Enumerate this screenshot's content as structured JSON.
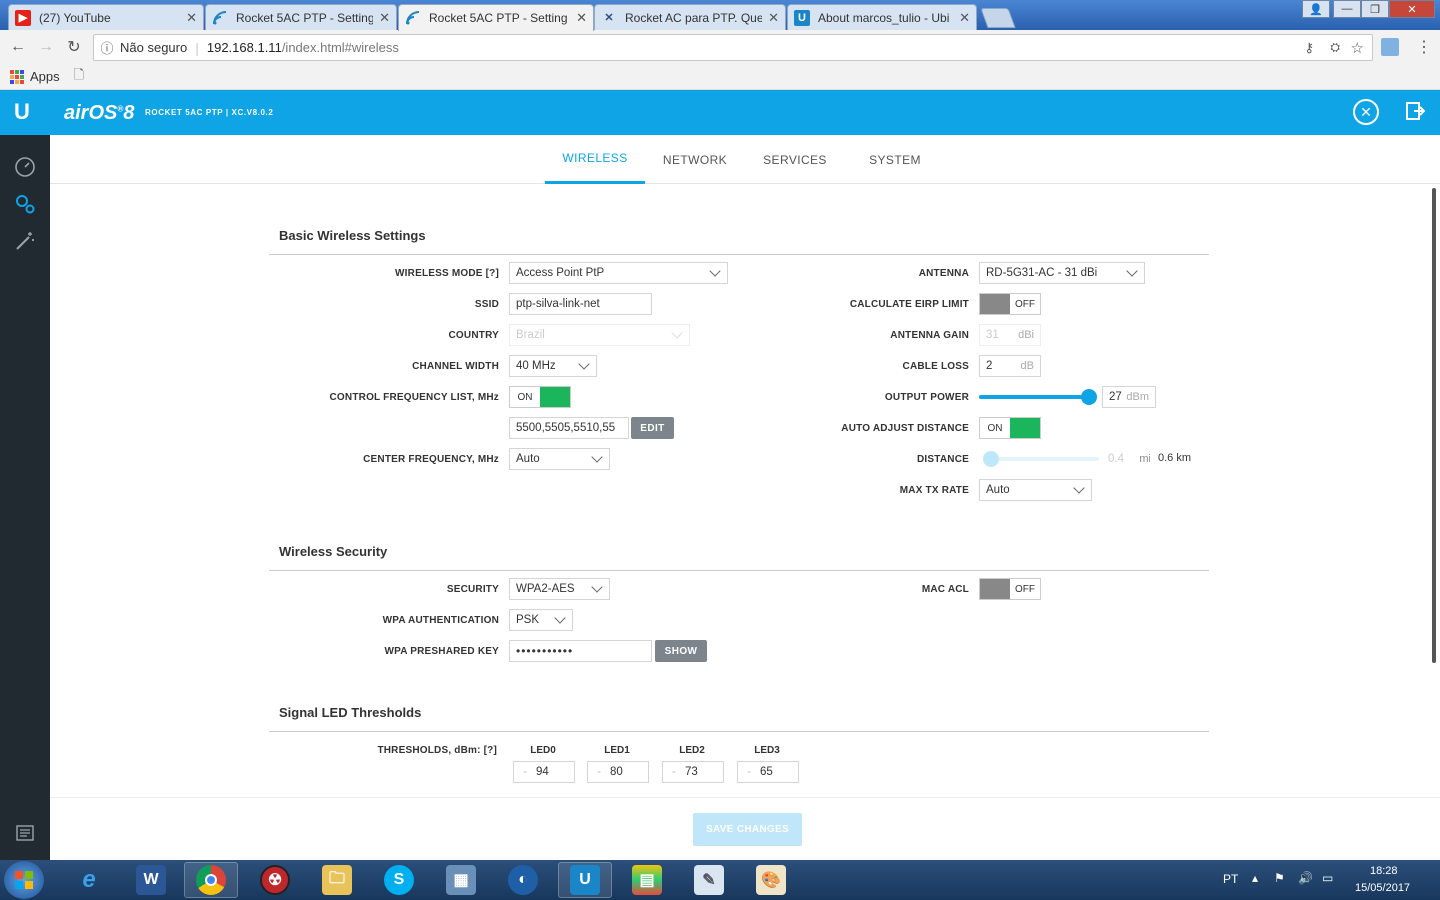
{
  "browser": {
    "tabs": [
      {
        "title": "(27) YouTube",
        "icon": "youtube-icon"
      },
      {
        "title": "Rocket 5AC PTP - Setting",
        "icon": "wifi-icon"
      },
      {
        "title": "Rocket 5AC PTP - Setting",
        "icon": "wifi-icon",
        "active": true
      },
      {
        "title": "Rocket AC para PTP. Que",
        "icon": "x-icon"
      },
      {
        "title": "About marcos_tulio - Ubi",
        "icon": "ubiquiti-icon"
      }
    ],
    "security_label": "Não seguro",
    "url_host": "192.168.1.11",
    "url_path": "/index.html#wireless",
    "bookmarks_apps": "Apps"
  },
  "app": {
    "logo_text": "airOS",
    "logo_version": "8",
    "device": "ROCKET 5AC PTP | XC.V8.0.2"
  },
  "tabs": [
    "WIRELESS",
    "NETWORK",
    "SERVICES",
    "SYSTEM"
  ],
  "basic": {
    "title": "Basic Wireless Settings",
    "wireless_mode_label": "WIRELESS MODE [?]",
    "wireless_mode": "Access Point PtP",
    "ssid_label": "SSID",
    "ssid": "ptp-silva-link-net",
    "country_label": "COUNTRY",
    "country": "Brazil",
    "channel_width_label": "CHANNEL WIDTH",
    "channel_width": "40 MHz",
    "cfl_label": "CONTROL FREQUENCY LIST, MHz",
    "cfl_toggle": "ON",
    "cfl_value": "5500,5505,5510,55",
    "edit_label": "EDIT",
    "center_freq_label": "CENTER FREQUENCY, MHz",
    "center_freq": "Auto",
    "antenna_label": "ANTENNA",
    "antenna": "RD-5G31-AC - 31 dBi",
    "eirp_label": "CALCULATE EIRP LIMIT",
    "eirp_toggle": "OFF",
    "antenna_gain_label": "ANTENNA GAIN",
    "antenna_gain": "31",
    "antenna_gain_unit": "dBi",
    "cable_loss_label": "CABLE LOSS",
    "cable_loss": "2",
    "cable_loss_unit": "dB",
    "output_power_label": "OUTPUT POWER",
    "output_power": "27",
    "output_power_unit": "dBm",
    "output_power_level": 1.0,
    "auto_adjust_label": "AUTO ADJUST DISTANCE",
    "auto_adjust_toggle": "ON",
    "distance_label": "DISTANCE",
    "distance_mi": "0.4",
    "distance_mi_unit": "mi.",
    "distance_km": "0.6 km",
    "distance_level": 0.0,
    "max_tx_label": "MAX TX RATE",
    "max_tx": "Auto"
  },
  "security": {
    "title": "Wireless Security",
    "security_label": "SECURITY",
    "security": "WPA2-AES",
    "wpa_auth_label": "WPA AUTHENTICATION",
    "wpa_auth": "PSK",
    "psk_label": "WPA PRESHARED KEY",
    "psk": "•••••••••••",
    "show_label": "SHOW",
    "macacl_label": "MAC ACL",
    "macacl_toggle": "OFF"
  },
  "led": {
    "title": "Signal LED Thresholds",
    "thresholds_label": "THRESHOLDS, dBm: [?]",
    "items": [
      {
        "name": "LED0",
        "value": "94"
      },
      {
        "name": "LED1",
        "value": "80"
      },
      {
        "name": "LED2",
        "value": "73"
      },
      {
        "name": "LED3",
        "value": "65"
      }
    ],
    "minus": "-"
  },
  "save_label": "SAVE CHANGES",
  "taskbar": {
    "lang": "PT",
    "time": "18:28",
    "date": "15/05/2017"
  },
  "colors": {
    "accent": "#0ea4e6",
    "toggle_on": "#1bb55c",
    "toggle_off": "#888888",
    "sidebar": "#222a31"
  }
}
